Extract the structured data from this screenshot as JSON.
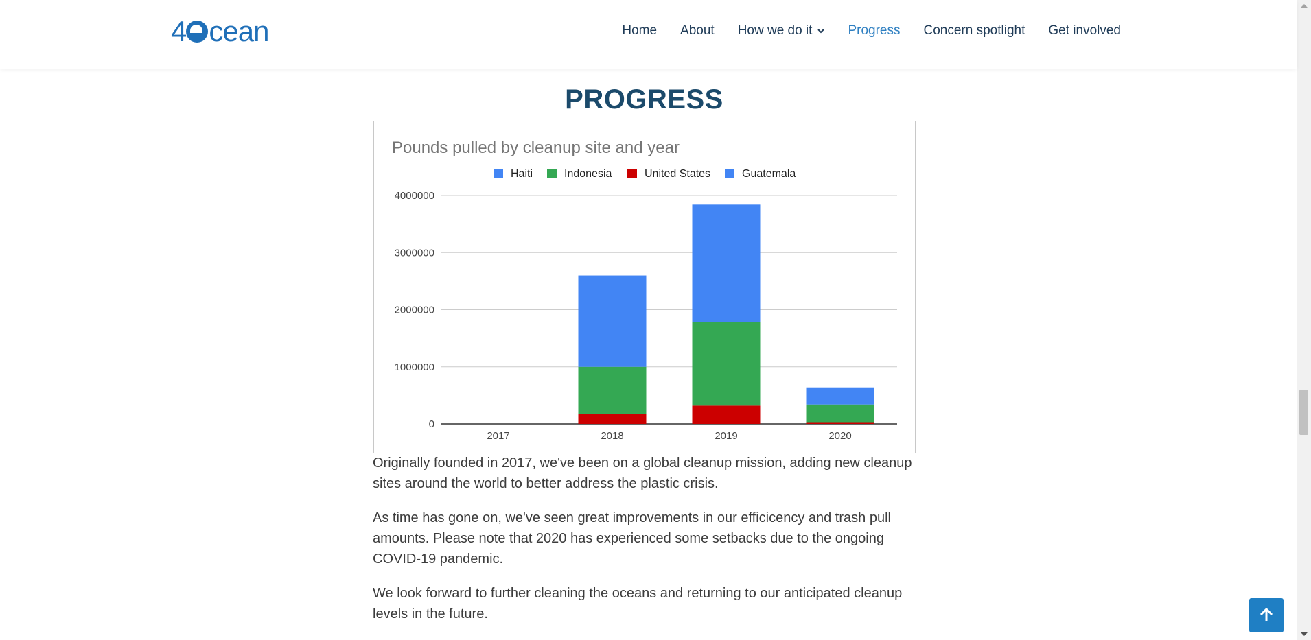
{
  "header": {
    "logo_text": "4Ocean",
    "nav": [
      {
        "label": "Home"
      },
      {
        "label": "About"
      },
      {
        "label": "How we do it"
      },
      {
        "label": "Progress"
      },
      {
        "label": "Concern spotlight"
      },
      {
        "label": "Get involved"
      }
    ]
  },
  "page": {
    "title": "PROGRESS"
  },
  "chart_data": {
    "type": "bar",
    "stacked": true,
    "title": "Pounds pulled by cleanup site and year",
    "categories": [
      "2017",
      "2018",
      "2019",
      "2020"
    ],
    "series": [
      {
        "name": "United States",
        "color": "#cc0000",
        "values": [
          0,
          170000,
          320000,
          30000
        ]
      },
      {
        "name": "Indonesia",
        "color": "#34a853",
        "values": [
          0,
          830000,
          1460000,
          310000
        ]
      },
      {
        "name": "Haiti",
        "color": "#4285f4",
        "values": [
          0,
          1600000,
          2060000,
          300000
        ]
      },
      {
        "name": "Guatemala",
        "color": "#4285f4",
        "values": [
          0,
          0,
          0,
          0
        ]
      }
    ],
    "legend_order": [
      "Haiti",
      "Indonesia",
      "United States",
      "Guatemala"
    ],
    "y_ticks": [
      "0",
      "1000000",
      "2000000",
      "3000000",
      "4000000"
    ],
    "ylim": [
      0,
      4000000
    ],
    "grid": true,
    "legend_position": "top"
  },
  "body": {
    "paragraphs": [
      "Originally founded in 2017, we've been on a global cleanup mission, adding new cleanup sites around the world to better address the plastic crisis.",
      "As time has gone on, we've seen great improvements in our efficicency and trash pull amounts. Please note that 2020 has experienced some setbacks due to the ongoing COVID-19 pandemic.",
      "We look forward to further cleaning the oceans and returning to our anticipated cleanup levels in the future."
    ]
  },
  "icons": {
    "back_to_top": "arrow-up-icon",
    "dropdown": "chevron-down-icon"
  }
}
